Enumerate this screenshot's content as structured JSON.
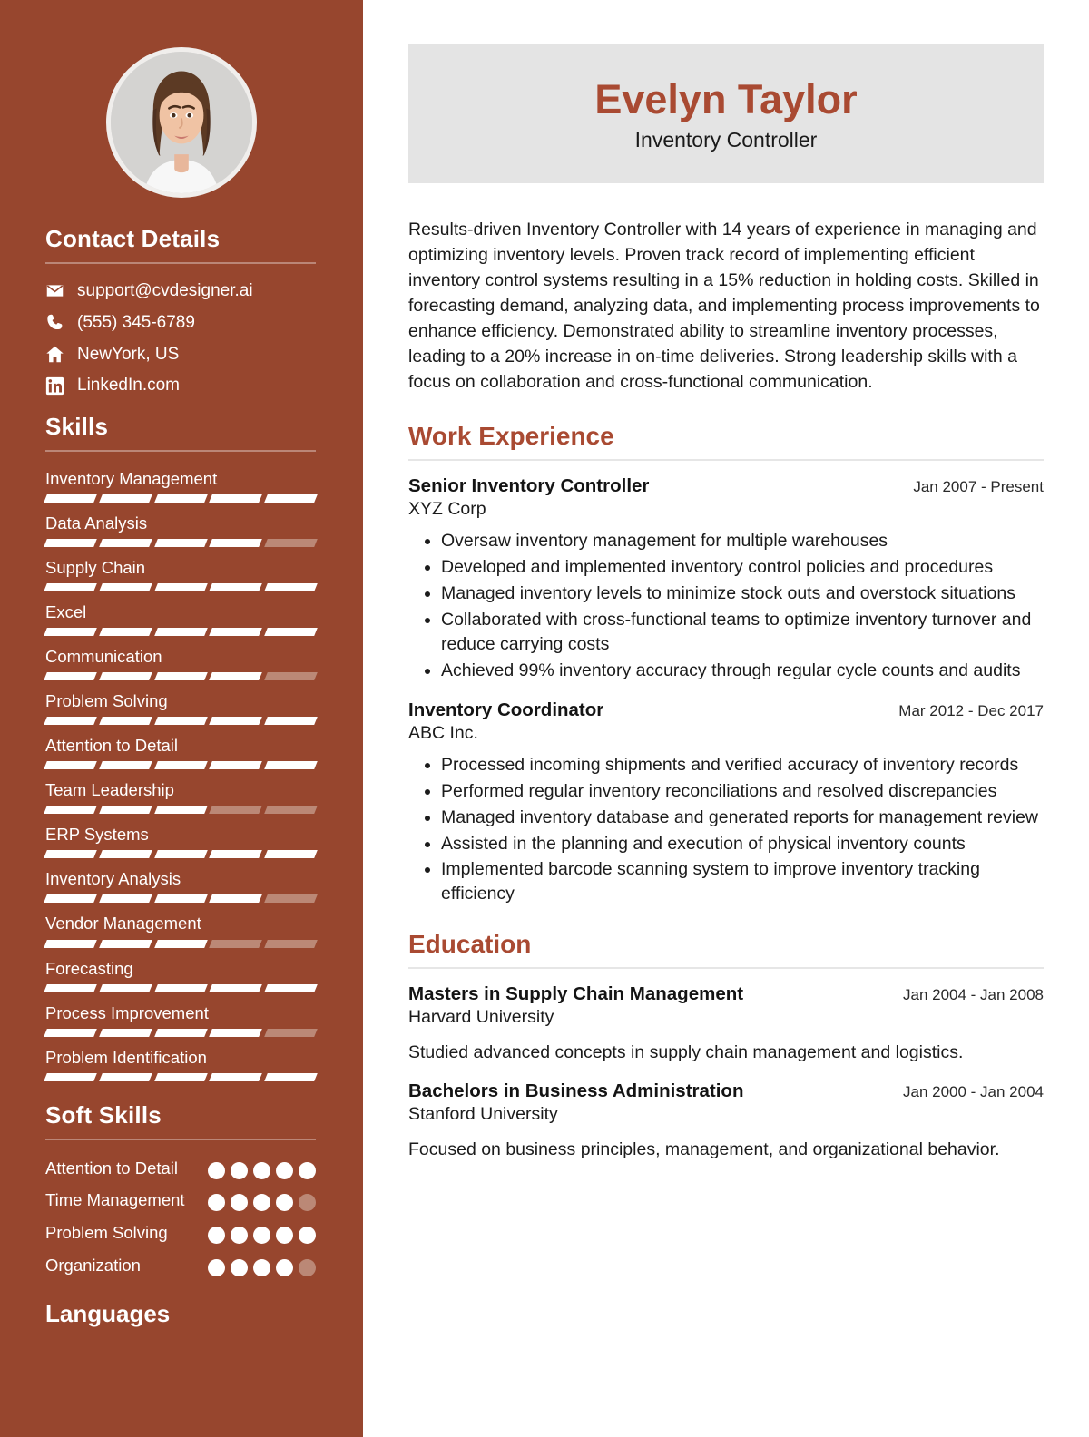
{
  "sidebar": {
    "avatar_alt": "profile-photo",
    "contact": {
      "heading": "Contact Details",
      "items": [
        {
          "icon": "envelope-icon",
          "value": "support@cvdesigner.ai"
        },
        {
          "icon": "phone-icon",
          "value": "(555) 345-6789"
        },
        {
          "icon": "home-icon",
          "value": "NewYork, US"
        },
        {
          "icon": "linkedin-icon",
          "value": "LinkedIn.com"
        }
      ]
    },
    "skills": {
      "heading": "Skills",
      "max_level": 5,
      "items": [
        {
          "label": "Inventory Management",
          "level": 5
        },
        {
          "label": "Data Analysis",
          "level": 4
        },
        {
          "label": "Supply Chain",
          "level": 5
        },
        {
          "label": "Excel",
          "level": 5
        },
        {
          "label": "Communication",
          "level": 4
        },
        {
          "label": "Problem Solving",
          "level": 5
        },
        {
          "label": "Attention to Detail",
          "level": 5
        },
        {
          "label": "Team Leadership",
          "level": 3
        },
        {
          "label": "ERP Systems",
          "level": 5
        },
        {
          "label": "Inventory Analysis",
          "level": 4
        },
        {
          "label": "Vendor Management",
          "level": 3
        },
        {
          "label": "Forecasting",
          "level": 5
        },
        {
          "label": "Process Improvement",
          "level": 4
        },
        {
          "label": "Problem Identification",
          "level": 5
        }
      ]
    },
    "soft_skills": {
      "heading": "Soft Skills",
      "max_level": 5,
      "items": [
        {
          "label": "Attention to Detail",
          "level": 5
        },
        {
          "label": "Time Management",
          "level": 4
        },
        {
          "label": "Problem Solving",
          "level": 5
        },
        {
          "label": "Organization",
          "level": 4
        }
      ]
    },
    "languages_heading": "Languages"
  },
  "header": {
    "name": "Evelyn Taylor",
    "role": "Inventory Controller"
  },
  "summary": "Results-driven Inventory Controller with 14 years of experience in managing and optimizing inventory levels. Proven track record of implementing efficient inventory control systems resulting in a 15% reduction in holding costs. Skilled in forecasting demand, analyzing data, and implementing process improvements to enhance efficiency. Demonstrated ability to streamline inventory processes, leading to a 20% increase in on-time deliveries. Strong leadership skills with a focus on collaboration and cross-functional communication.",
  "work": {
    "heading": "Work Experience",
    "entries": [
      {
        "title": "Senior Inventory Controller",
        "date": "Jan 2007 - Present",
        "org": "XYZ Corp",
        "bullets": [
          "Oversaw inventory management for multiple warehouses",
          "Developed and implemented inventory control policies and procedures",
          "Managed inventory levels to minimize stock outs and overstock situations",
          "Collaborated with cross-functional teams to optimize inventory turnover and reduce carrying costs",
          "Achieved 99% inventory accuracy through regular cycle counts and audits"
        ]
      },
      {
        "title": "Inventory Coordinator",
        "date": "Mar 2012 - Dec 2017",
        "org": "ABC Inc.",
        "bullets": [
          "Processed incoming shipments and verified accuracy of inventory records",
          "Performed regular inventory reconciliations and resolved discrepancies",
          "Managed inventory database and generated reports for management review",
          "Assisted in the planning and execution of physical inventory counts",
          "Implemented barcode scanning system to improve inventory tracking efficiency"
        ]
      }
    ]
  },
  "education": {
    "heading": "Education",
    "entries": [
      {
        "title": "Masters in Supply Chain Management",
        "date": "Jan 2004 - Jan 2008",
        "org": "Harvard University",
        "desc": "Studied advanced concepts in supply chain management and logistics."
      },
      {
        "title": "Bachelors in Business Administration",
        "date": "Jan 2000 - Jan 2004",
        "org": "Stanford University",
        "desc": "Focused on business principles, management, and organizational behavior."
      }
    ]
  },
  "colors": {
    "sidebar_bg": "#97462e",
    "accent": "#a94a32",
    "namecard_bg": "#e4e4e4",
    "bar_on": "#ffffff",
    "bar_off": "#bb8876"
  }
}
